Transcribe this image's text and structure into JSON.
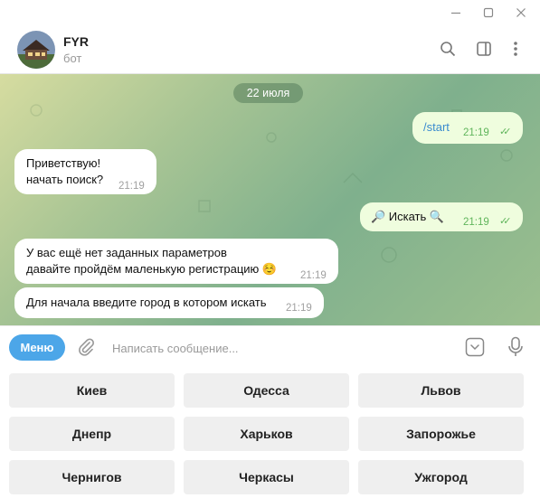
{
  "header": {
    "title": "FYR",
    "subtitle": "бот"
  },
  "chat": {
    "date": "22 июля",
    "messages": [
      {
        "dir": "out",
        "text": "/start",
        "time": "21:19"
      },
      {
        "dir": "in",
        "lines": [
          "Приветствую!",
          "начать поиск?"
        ],
        "time": "21:19"
      },
      {
        "dir": "out",
        "text": "🔎 Искать 🔍",
        "time": "21:19"
      },
      {
        "dir": "in",
        "lines": [
          "У вас ещё нет заданных параметров",
          "давайте пройдём маленькую регистрацию ☺️"
        ],
        "time": "21:19"
      },
      {
        "dir": "in",
        "text": "Для начала введите город в котором искать",
        "time": "21:19"
      }
    ]
  },
  "input": {
    "menu_label": "Меню",
    "placeholder": "Написать сообщение..."
  },
  "keyboard": {
    "rows": [
      [
        "Киев",
        "Одесса",
        "Львов"
      ],
      [
        "Днепр",
        "Харьков",
        "Запорожье"
      ],
      [
        "Чернигов",
        "Черкасы",
        "Ужгород"
      ]
    ]
  },
  "colors": {
    "accent": "#4ca6e8",
    "outgoing_bubble": "#effdde",
    "check": "#5fb55b"
  },
  "icons": [
    "minimize-icon",
    "maximize-icon",
    "close-icon",
    "search-icon",
    "sidebar-icon",
    "more-icon",
    "attach-icon",
    "keyboard-icon",
    "mic-icon"
  ]
}
